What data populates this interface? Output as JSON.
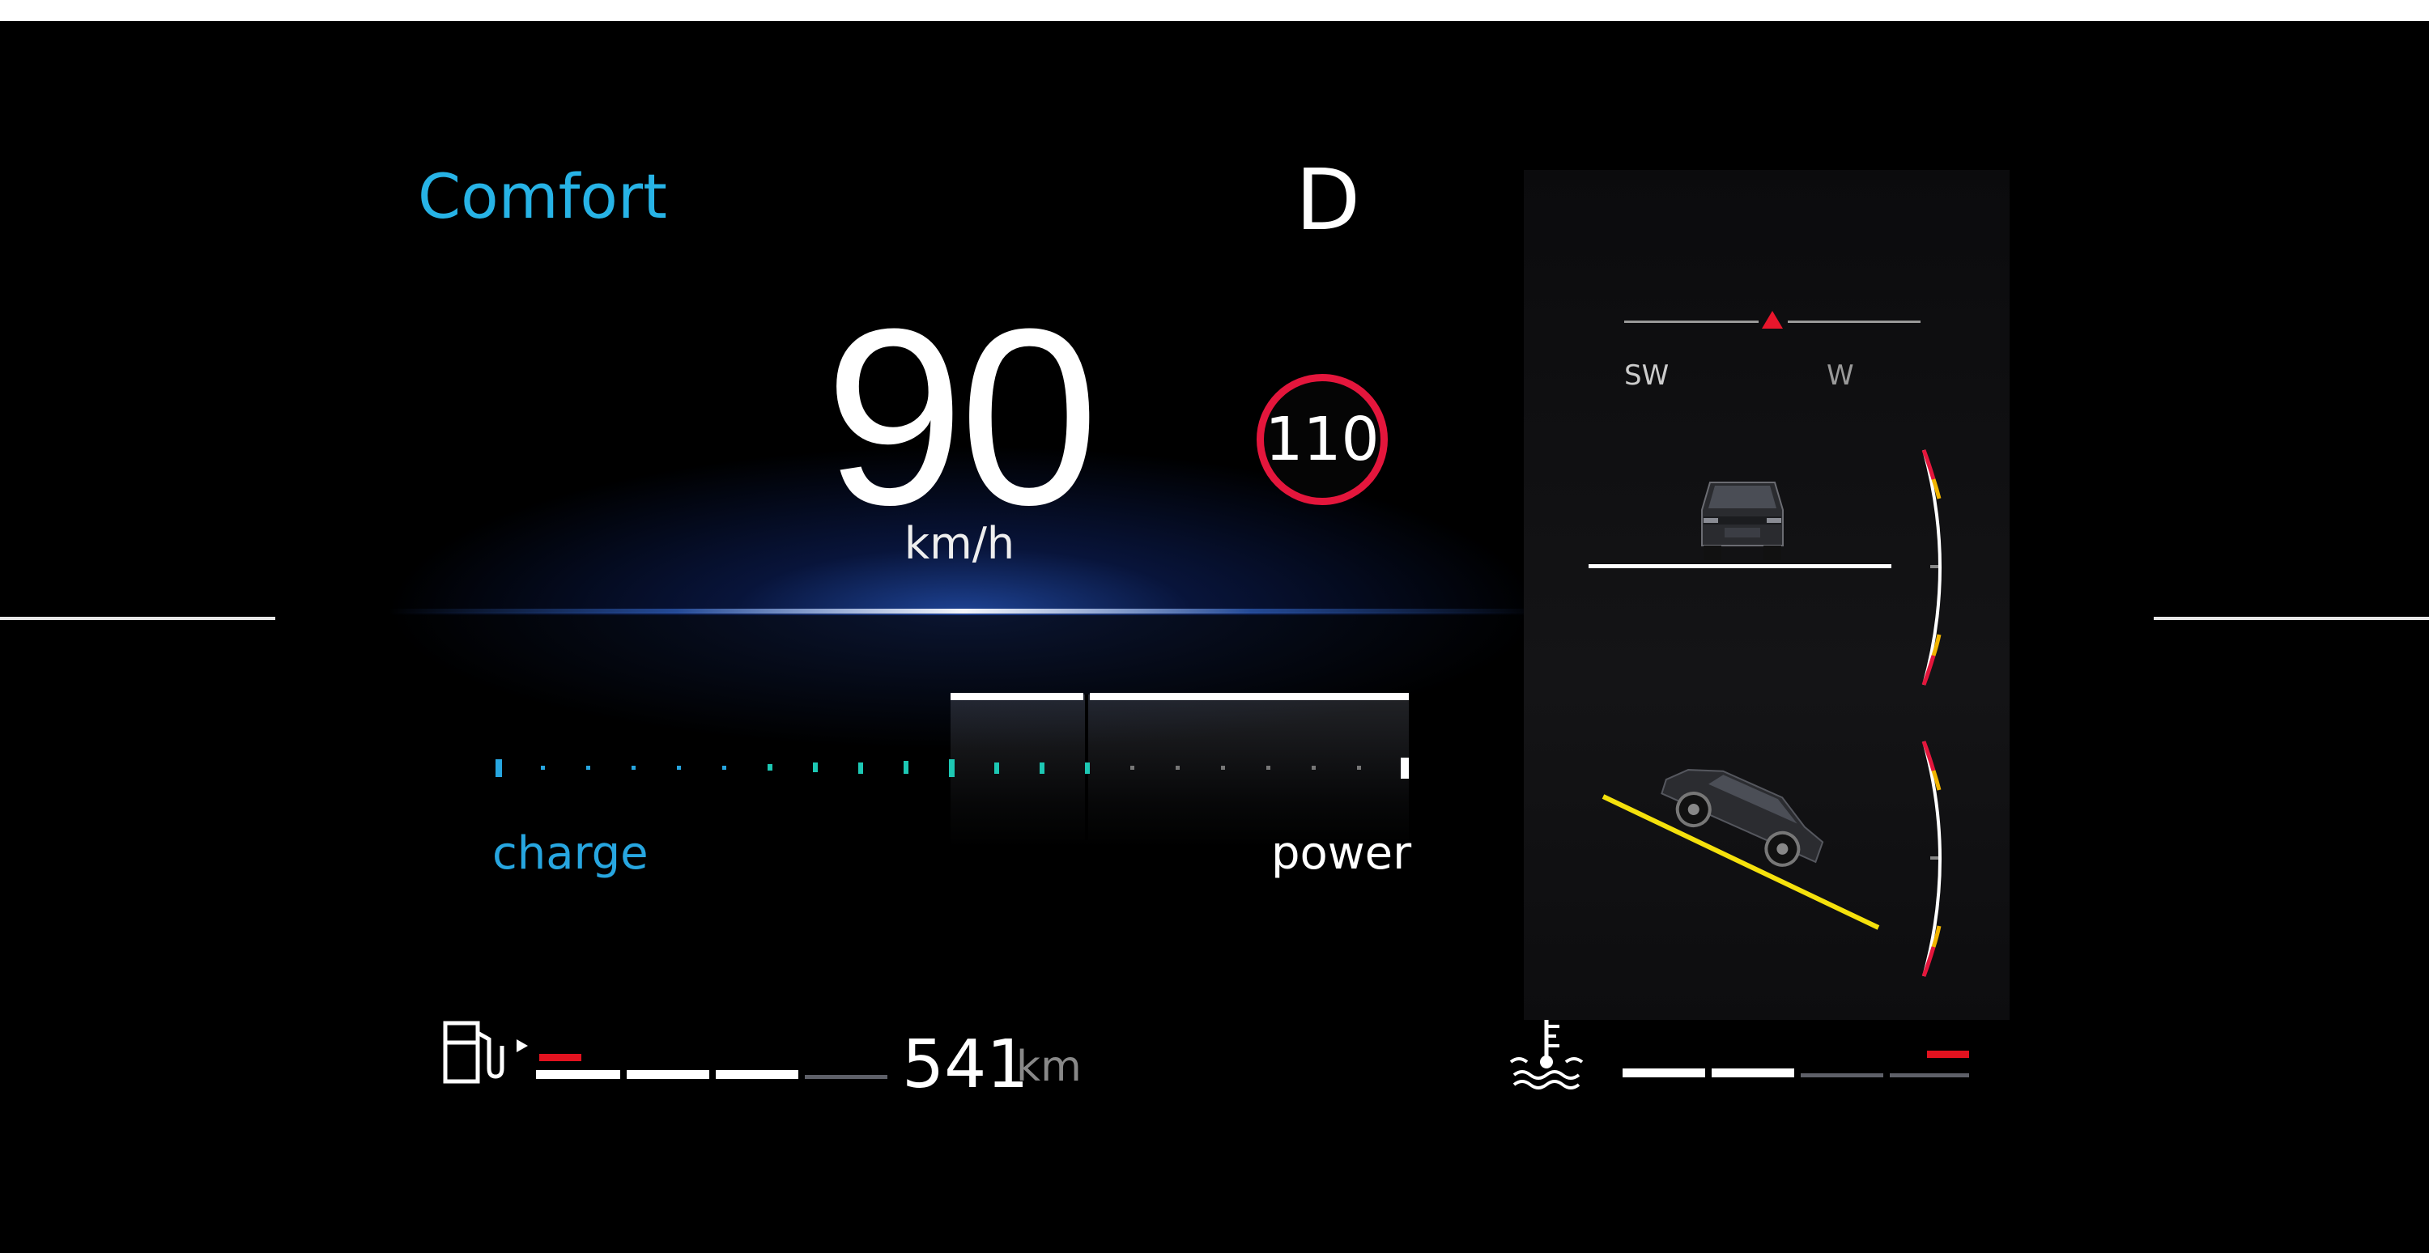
{
  "drive_mode": "Comfort",
  "gear": "D",
  "speed": {
    "value": "90",
    "unit": "km/h"
  },
  "speed_limit": "110",
  "compass": {
    "left": "SW",
    "right": "W"
  },
  "power_gauge": {
    "left_label": "charge",
    "right_label": "power",
    "charge_color": "#27a6e0",
    "regen_color": "#1dc8b4"
  },
  "fuel": {
    "icon": "fuel-pump-icon",
    "range_value": "541",
    "range_unit": "km",
    "level_segments_on": 3,
    "level_segments_total": 4
  },
  "coolant": {
    "icon": "coolant-temperature-icon",
    "level_segments_on": 2,
    "level_segments_total": 4
  },
  "inclinometer": {
    "roll_icon": "car-rear-view-icon",
    "pitch_icon": "car-side-view-icon",
    "slope_color": "#f5e10c"
  },
  "colors": {
    "accent": "#27b3e6",
    "warning": "#e4163c",
    "caution": "#f0b400"
  }
}
